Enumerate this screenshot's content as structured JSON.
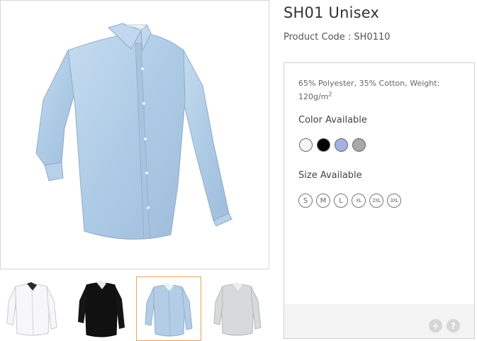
{
  "product": {
    "title": "SH01 Unisex",
    "code_label": "Product Code : ",
    "code_value": "SH0110"
  },
  "details": {
    "description": "65% Polyester, 35% Cotton, Weight: 120g/m",
    "description_sup": "2",
    "color_heading": "Color Available",
    "colors": [
      {
        "name": "white",
        "hex": "#f5f5f5"
      },
      {
        "name": "black",
        "hex": "#050505"
      },
      {
        "name": "light-blue",
        "hex": "#a5b1e0"
      },
      {
        "name": "grey",
        "hex": "#a9a9a9"
      }
    ],
    "size_heading": "Size Available",
    "sizes": [
      "S",
      "M",
      "L",
      "XL",
      "2XL",
      "3XL"
    ]
  },
  "gallery": {
    "main_image": "light-blue-shirt",
    "thumbnails": [
      {
        "name": "white-shirt",
        "color": "#f7f7f9"
      },
      {
        "name": "black-shirt",
        "color": "#111111"
      },
      {
        "name": "light-blue-shirt",
        "color": "#b3cde6"
      },
      {
        "name": "grey-shirt",
        "color": "#d7dada"
      }
    ],
    "active_thumbnail": 2
  },
  "footer": {
    "plus_label": "+",
    "help_label": "?"
  }
}
